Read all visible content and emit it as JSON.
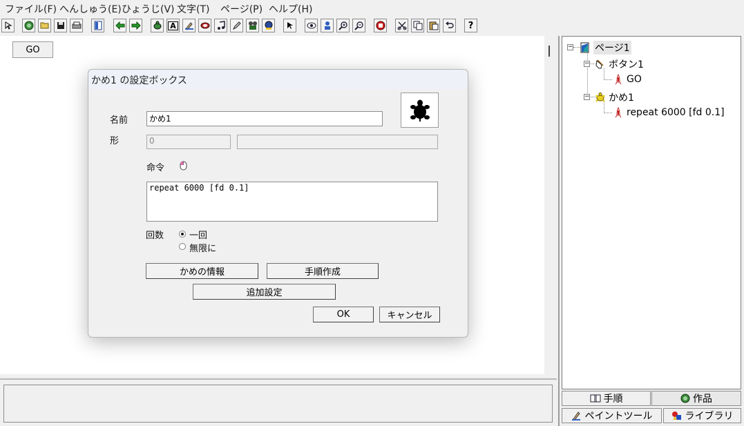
{
  "menubar": {
    "items": [
      "ファイル(F)",
      "へんしゅう(E)",
      "ひょうじ(V)",
      "文字(T)",
      "ページ(P)",
      "ヘルプ(H)"
    ]
  },
  "toolbar": {
    "icons": [
      "cursor-arrow-icon",
      "new-page-icon",
      "open-folder-icon",
      "save-disk-icon",
      "print-icon",
      "layout-icon",
      "back-arrow-icon",
      "forward-arrow-icon",
      "turtle-add-icon",
      "text-A-icon",
      "paint-icon",
      "stamp-icon",
      "music-note-icon",
      "pen-icon",
      "movie-icon",
      "record-icon",
      "pointer-icon",
      "eye-icon",
      "person-icon",
      "zoom-in-icon",
      "zoom-out-icon",
      "stop-hand-icon",
      "cut-icon",
      "copy-icon",
      "paste-icon",
      "undo-icon",
      "help-icon"
    ],
    "help_label": "?",
    "text_label": "A"
  },
  "canvas": {
    "go_button_label": "GO"
  },
  "dialog": {
    "title": "かめ1 の設定ボックス",
    "name_label": "名前",
    "name_value": "かめ1",
    "shape_label": "形",
    "shape_value": "0",
    "shape_extra": "",
    "command_label": "命令",
    "command_value": "repeat 6000 [fd 0.1]",
    "count_label": "回数",
    "radio_once": "一回",
    "radio_infinite": "無限に",
    "selected_radio": "once",
    "btn_info": "かめの情報",
    "btn_procedure": "手順作成",
    "btn_extra": "追加設定",
    "btn_ok": "OK",
    "btn_cancel": "キャンセル"
  },
  "tree": {
    "page": "ページ1",
    "button": "ボタン1",
    "button_child": "GO",
    "turtle": "かめ1",
    "turtle_child": "repeat 6000 [fd 0.1]"
  },
  "tabs": {
    "procedure": "手順",
    "works": "作品",
    "paint_tool": "ペイントツール",
    "library": "ライブラリ"
  }
}
